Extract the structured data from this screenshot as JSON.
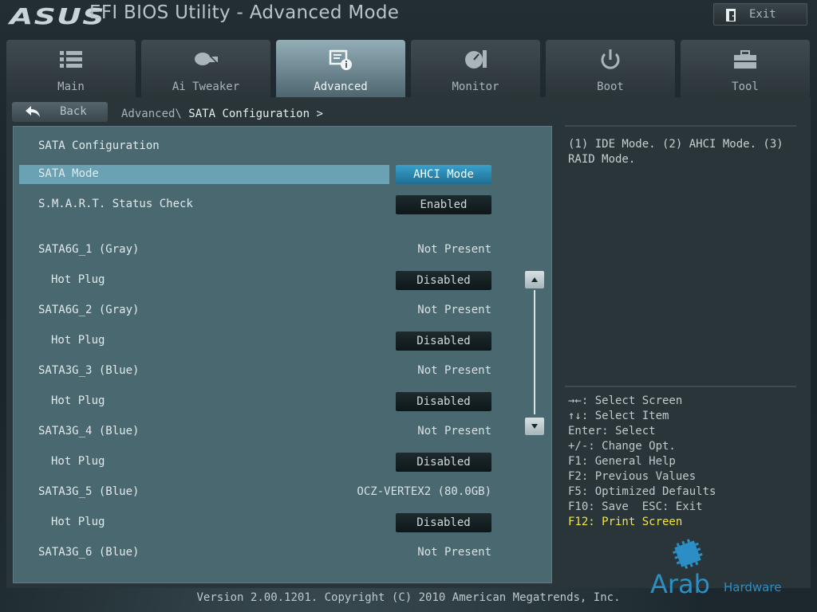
{
  "header": {
    "logo": "ASUS",
    "title": "EFI BIOS Utility - Advanced Mode",
    "exit_label": "Exit"
  },
  "tabs": [
    {
      "label": "Main",
      "icon": "list-icon"
    },
    {
      "label": "Ai Tweaker",
      "icon": "ai-tweaker-icon"
    },
    {
      "label": "Advanced",
      "icon": "advanced-icon"
    },
    {
      "label": "Monitor",
      "icon": "monitor-gauge-icon"
    },
    {
      "label": "Boot",
      "icon": "power-icon"
    },
    {
      "label": "Tool",
      "icon": "toolbox-icon"
    }
  ],
  "nav": {
    "back_label": "Back",
    "breadcrumb_parent": "Advanced\\",
    "breadcrumb_current": "SATA Configuration >"
  },
  "panel": {
    "section_title": "SATA Configuration",
    "sata_mode_label": "SATA Mode",
    "sata_mode_value": "AHCI Mode",
    "smart_label": "S.M.A.R.T. Status Check",
    "smart_value": "Enabled",
    "ports": [
      {
        "label": "SATA6G_1 (Gray)",
        "status": "Not Present",
        "hotplug_label": "Hot Plug",
        "hotplug_value": "Disabled"
      },
      {
        "label": "SATA6G_2 (Gray)",
        "status": "Not Present",
        "hotplug_label": "Hot Plug",
        "hotplug_value": "Disabled"
      },
      {
        "label": "SATA3G_3 (Blue)",
        "status": "Not Present",
        "hotplug_label": "Hot Plug",
        "hotplug_value": "Disabled"
      },
      {
        "label": "SATA3G_4 (Blue)",
        "status": "Not Present",
        "hotplug_label": "Hot Plug",
        "hotplug_value": "Disabled"
      },
      {
        "label": "SATA3G_5 (Blue)",
        "status": "OCZ-VERTEX2 (80.0GB)",
        "hotplug_label": "Hot Plug",
        "hotplug_value": "Disabled"
      },
      {
        "label": "SATA3G_6 (Blue)",
        "status": "Not Present"
      }
    ]
  },
  "help": {
    "description": "(1) IDE Mode. (2) AHCI Mode. (3) RAID Mode.",
    "keys": [
      "→←: Select Screen",
      "↑↓: Select Item",
      "Enter: Select",
      "+/-: Change Opt.",
      "F1: General Help",
      "F2: Previous Values",
      "F5: Optimized Defaults",
      "F10: Save  ESC: Exit",
      "F12: Print Screen"
    ]
  },
  "footer": {
    "version": "Version 2.00.1201. Copyright (C) 2010 American Megatrends, Inc."
  },
  "watermark": {
    "text_main": "Arab",
    "text_sub": "Hardware"
  },
  "colors": {
    "accent_button": "#2a8ab8",
    "selected_row": "#6aa2b4",
    "panel_bg": "#4a6870",
    "highlight_key": "#f3e63a"
  }
}
